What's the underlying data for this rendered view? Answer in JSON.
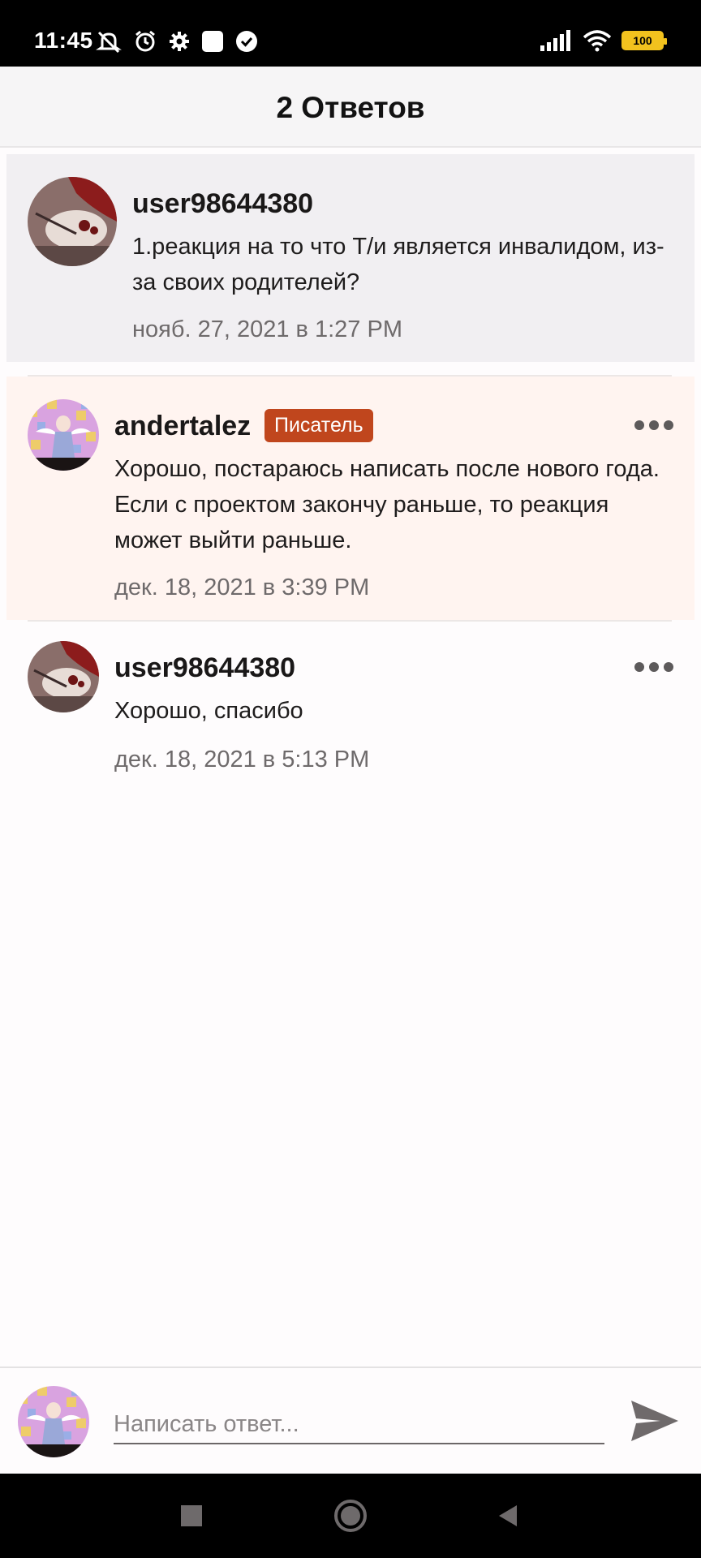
{
  "status_bar": {
    "time": "11:45",
    "battery": "100",
    "left_icons": [
      "mute-icon",
      "alarm-icon",
      "settings-icon",
      "square-icon",
      "check-circle-icon"
    ],
    "right_icons": [
      "signal-icon",
      "wifi-icon",
      "battery-icon"
    ]
  },
  "header": {
    "title": "2 Ответов"
  },
  "comments": [
    {
      "username": "user98644380",
      "text": "1.реакция на то что Т/и является инвалидом, из-за своих родителей?",
      "timestamp": "нояб. 27, 2021 в 1:27 PM"
    },
    {
      "username": "andertalez",
      "badge": "Писатель",
      "text": "Хорошо, постараюсь написать после нового года. Если с проектом закончу раньше, то реакция может выйти раньше.",
      "timestamp": "дек. 18, 2021 в 3:39 PM"
    },
    {
      "username": "user98644380",
      "text": "Хорошо, спасибо",
      "timestamp": "дек. 18, 2021 в 5:13 PM"
    }
  ],
  "reply": {
    "placeholder": "Написать ответ..."
  },
  "colors": {
    "writer_badge": "#c0461d",
    "author_highlight": "#fff4f0",
    "parent_bg": "#f1eff2"
  }
}
